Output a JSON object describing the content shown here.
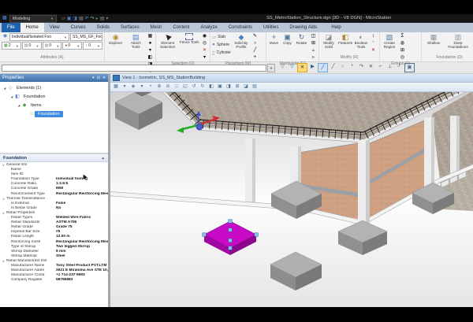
{
  "app": {
    "workflow": "Modeling",
    "title": "SS_MetroStation_Structure.dgn [3D - V8 DGN] - MicroStation",
    "qat_icons": [
      {
        "g": "▱",
        "c": "#e2a33c",
        "name": "open-icon"
      },
      {
        "g": "▣",
        "c": "#4a7fc0",
        "name": "save-icon"
      },
      {
        "g": "◨",
        "c": "#4a7fc0",
        "name": "save-settings-icon"
      },
      {
        "g": "▤",
        "c": "#9a9a9a",
        "name": "compress-icon"
      },
      {
        "g": "↶",
        "c": "#5b9bd5",
        "name": "undo-icon"
      },
      {
        "g": "↷",
        "c": "#9aa7b5",
        "name": "redo-icon"
      },
      {
        "g": "▸",
        "c": "#3a9a3a",
        "name": "play-icon"
      },
      {
        "g": "▤",
        "c": "#8a8a8a",
        "name": "print-icon"
      },
      {
        "g": "▾",
        "c": "#8a8a8a",
        "name": "qat-more-icon"
      }
    ]
  },
  "tabs": [
    {
      "label": "File",
      "cls": "file"
    },
    {
      "label": "Home",
      "cls": "active"
    },
    {
      "label": "View"
    },
    {
      "label": "Curves"
    },
    {
      "label": "Solids"
    },
    {
      "label": "Surfaces"
    },
    {
      "label": "Mesh"
    },
    {
      "label": "Content"
    },
    {
      "label": "Analyze"
    },
    {
      "label": "Constraints"
    },
    {
      "label": "Utilities"
    },
    {
      "label": "Drawing Aids"
    },
    {
      "label": "Help",
      "cls": "help"
    }
  ],
  "ribbon": {
    "attributes": {
      "label": "Attributes (A)",
      "dropdown1": "Individual/Isolated Foo",
      "dropdown2": "SS_MS_GF_Footing",
      "row2": [
        {
          "g": "▦",
          "c": "#3a9a3a",
          "v": "2",
          "name": "active-level-icon"
        },
        {
          "g": "▧",
          "c": "#888888",
          "v": "0",
          "name": "active-color-icon"
        },
        {
          "g": "▨",
          "c": "#888888",
          "v": "0",
          "name": "line-style-icon"
        },
        {
          "g": "●",
          "c": "#b46a2a",
          "v": "0",
          "name": "line-weight-icon"
        },
        {
          "g": "◐",
          "c": "#aaaaaa",
          "v": "0",
          "name": "transparency-icon"
        }
      ]
    },
    "primary": {
      "label": "Primary (S)",
      "explorer": "Explorer",
      "attach": "Attach Tools",
      "minis": [
        {
          "g": "▦",
          "name": "models-icon"
        },
        {
          "g": "●",
          "name": "references-icon"
        },
        {
          "g": "▾",
          "name": "primary-more-icon"
        },
        {
          "g": "◧",
          "name": "raster-icon"
        },
        {
          "g": "◨",
          "name": "point-clouds-icon"
        },
        {
          "g": "▾",
          "name": "primary-more2-icon"
        }
      ]
    },
    "selection": {
      "label": "Selection (Q)",
      "element": "Element Selection",
      "fence": "Fence Tools",
      "minis": [
        {
          "g": "◉",
          "name": "select-all-icon"
        },
        {
          "g": "◎",
          "name": "select-none-icon"
        },
        {
          "g": "✕",
          "c": "#c03030",
          "name": "clear-fence-icon"
        },
        {
          "g": "▾",
          "name": "selection-more-icon"
        }
      ]
    },
    "placement": {
      "label": "Placement (W)",
      "slab": "Slab",
      "sphere": "Sphere",
      "cylinder": "Cylinder",
      "solid_by_profile": "Solid By Profile",
      "minis": [
        {
          "g": "✎",
          "name": "sketch-icon"
        },
        {
          "g": "○",
          "name": "ellipse-icon"
        },
        {
          "g": "╱",
          "name": "line-icon"
        },
        {
          "g": "+",
          "name": "point-icon"
        }
      ]
    },
    "manipulate": {
      "label": "Manipulate (E)",
      "move": "Move",
      "copy": "Copy",
      "rotate": "Rotate",
      "minis": [
        {
          "g": "◫",
          "name": "mirror-icon"
        },
        {
          "g": "⊞",
          "name": "array-icon"
        },
        {
          "g": "▵",
          "name": "scale-icon"
        },
        {
          "g": "▹",
          "name": "manipulate-more-icon"
        }
      ]
    },
    "modify": {
      "label": "Modify (R)",
      "modify_solid": "Modify Solid",
      "features": "Features",
      "boolean": "Boolean Tools",
      "minis": [
        {
          "g": "↕",
          "name": "stretch-icon"
        },
        {
          "g": "*",
          "c": "#b8860b",
          "name": "fillet-icon"
        },
        {
          "g": "✕",
          "c": "#cc1111",
          "name": "delete-icon"
        }
      ]
    },
    "groups": {
      "label": "Groups (T)",
      "create_region": "Create Region",
      "minis": [
        {
          "g": "Σ",
          "name": "drop-element-icon"
        },
        {
          "g": "◍",
          "name": "group-hole-icon"
        },
        {
          "g": "⊞",
          "name": "graphic-group-icon"
        },
        {
          "g": "◎",
          "name": "groups-more-icon"
        }
      ]
    },
    "foundation": {
      "label": "Foundation (D)",
      "shallow": "Shallow",
      "deep": "Deep Foundations"
    }
  },
  "toolrow": {
    "keyin_value": "",
    "icons": [
      {
        "g": "▽",
        "name": "filter-edit-icon"
      },
      {
        "g": "▽",
        "name": "filter-icon"
      },
      {
        "g": "✕",
        "cls": "sel-amber",
        "name": "delete-fence-icon"
      },
      {
        "g": "▶",
        "cls": "cursorish",
        "name": "element-select-icon"
      },
      {
        "g": "╱",
        "cls": "sel-blue",
        "name": "place-smartline-icon"
      },
      {
        "g": "╱",
        "name": "place-line-icon"
      },
      {
        "g": "○",
        "name": "place-circle-icon"
      },
      {
        "g": "*",
        "name": "modify-fillet-icon"
      },
      {
        "g": "↷",
        "name": "place-arc-icon"
      },
      {
        "g": "✕",
        "name": "delete-element-icon"
      },
      {
        "g": "⌐",
        "name": "trim-icon"
      },
      {
        "g": "⊥",
        "name": "break-icon"
      },
      {
        "g": "┘",
        "name": "corner-icon"
      },
      {
        "g": "▣",
        "cls": "boxed",
        "name": "selection-box-icon"
      }
    ]
  },
  "properties_panel": {
    "title": "Properties",
    "window_icons": [
      {
        "g": "▾",
        "name": "panel-menu-icon"
      },
      {
        "g": "⊡",
        "name": "panel-dock-icon"
      },
      {
        "g": "✕",
        "name": "panel-close-icon"
      }
    ],
    "tree": [
      {
        "exp": "◢",
        "icon": "◇",
        "iconcolor": "#7c8aa0",
        "iconname": "elements-icon",
        "label": "Elements (1)",
        "ind": "3px"
      },
      {
        "exp": "◢",
        "icon": "◧",
        "iconcolor": "#5b87c5",
        "iconname": "foundation-icon",
        "label": "Foundation",
        "ind": "12px"
      },
      {
        "exp": "◢",
        "icon": "◆",
        "iconcolor": "#43a047",
        "iconname": "items-icon",
        "label": "Items",
        "ind": "21px"
      },
      {
        "exp": "",
        "icon": "⊕",
        "iconcolor": "#bde8c5",
        "iconname": "foundation-item-icon",
        "label": "Foundation",
        "ind": "30px",
        "cls": "selected"
      }
    ],
    "section_title": "Foundation",
    "rows": [
      {
        "cls": "sec",
        "mark": "∨",
        "label": "General Info",
        "value": ""
      },
      {
        "label": "Name",
        "value": ""
      },
      {
        "label": "Item ID",
        "value": ""
      },
      {
        "label": "Foundation Type",
        "value": "Individual footing"
      },
      {
        "label": "Concrete Ratio",
        "value": "1:2.5:5"
      },
      {
        "label": "Concrete Grade",
        "value": "M50"
      },
      {
        "label": "Reinforcement Type",
        "value": "Rectangular Reinforcing Mesh"
      },
      {
        "cls": "sec",
        "mark": "∨",
        "label": "Thermal Transmittance",
        "value": ""
      },
      {
        "label": "Is External",
        "value": "False"
      },
      {
        "label": "Is Below Grade",
        "value": "No"
      },
      {
        "cls": "sec",
        "mark": "∨",
        "label": "Rebar Properties",
        "value": ""
      },
      {
        "label": "Rebar Types",
        "value": "Welded Wire Fabric"
      },
      {
        "label": "Rebar Standards",
        "value": "ASTM A706"
      },
      {
        "label": "Rebar Grade",
        "value": "Grade 75"
      },
      {
        "label": "Imperial Bar Size",
        "value": "#5"
      },
      {
        "label": "Rebar Length",
        "value": "12.00 m"
      },
      {
        "label": "Reinforcing mesh",
        "value": "Rectangular Reinforcing Mesh"
      },
      {
        "label": "Type of Stirrup",
        "value": "Two legged Stirrup"
      },
      {
        "label": "Stirrup Diameter",
        "value": "8 mm"
      },
      {
        "label": "Stirrup Material",
        "value": "Steel"
      },
      {
        "cls": "sec",
        "mark": "∨",
        "label": "Rebar Manufacturer Det",
        "value": ""
      },
      {
        "label": "Manufacturer Name",
        "value": "Tony Steel Product PVT.LTM"
      },
      {
        "label": "Manufacturer Addre",
        "value": "2921 E Miraloma Ave STE 10, An"
      },
      {
        "label": "Manufacturer Conta",
        "value": "+1 714-237-9993"
      },
      {
        "label": "Company Register",
        "value": "58796883"
      }
    ]
  },
  "view": {
    "title": "View 1 - Isometric, SS_MS_StationBuilding",
    "toolbar_icons": [
      {
        "g": "▦",
        "name": "display-style-icon"
      },
      {
        "g": "▾",
        "name": "display-style-caret-icon"
      },
      {
        "g": "◈",
        "name": "view-attributes-icon"
      },
      {
        "g": "▾",
        "name": "view-attributes-caret-icon"
      },
      {
        "g": "+",
        "name": "adjust-view-icon"
      },
      {
        "g": "⊕",
        "name": "zoom-in-icon"
      },
      {
        "g": "⊖",
        "name": "zoom-out-icon"
      },
      {
        "g": "□",
        "name": "fit-view-icon"
      },
      {
        "g": "◱",
        "name": "window-area-icon"
      },
      {
        "g": "↺",
        "name": "rotate-view-icon"
      },
      {
        "g": "↻",
        "name": "rotate-view-cw-icon"
      },
      {
        "g": "◧",
        "name": "pan-view-icon"
      },
      {
        "g": "▣",
        "name": "view-previous-icon"
      },
      {
        "g": "◨",
        "name": "view-next-icon"
      },
      {
        "g": "⊞",
        "name": "copy-view-icon"
      },
      {
        "g": "◪",
        "name": "clip-volume-icon"
      },
      {
        "g": "▤",
        "name": "clip-mask-icon"
      }
    ]
  },
  "colors": {
    "selection_magenta": "#c60ac6",
    "handle_blue": "#8fc1e8",
    "wall_tan": "#cfa082",
    "accent_blue": "#1e62ad",
    "gizmo_green": "#27ae27",
    "gizmo_red": "#cc3333",
    "gizmo_blue": "#3a56c8"
  }
}
